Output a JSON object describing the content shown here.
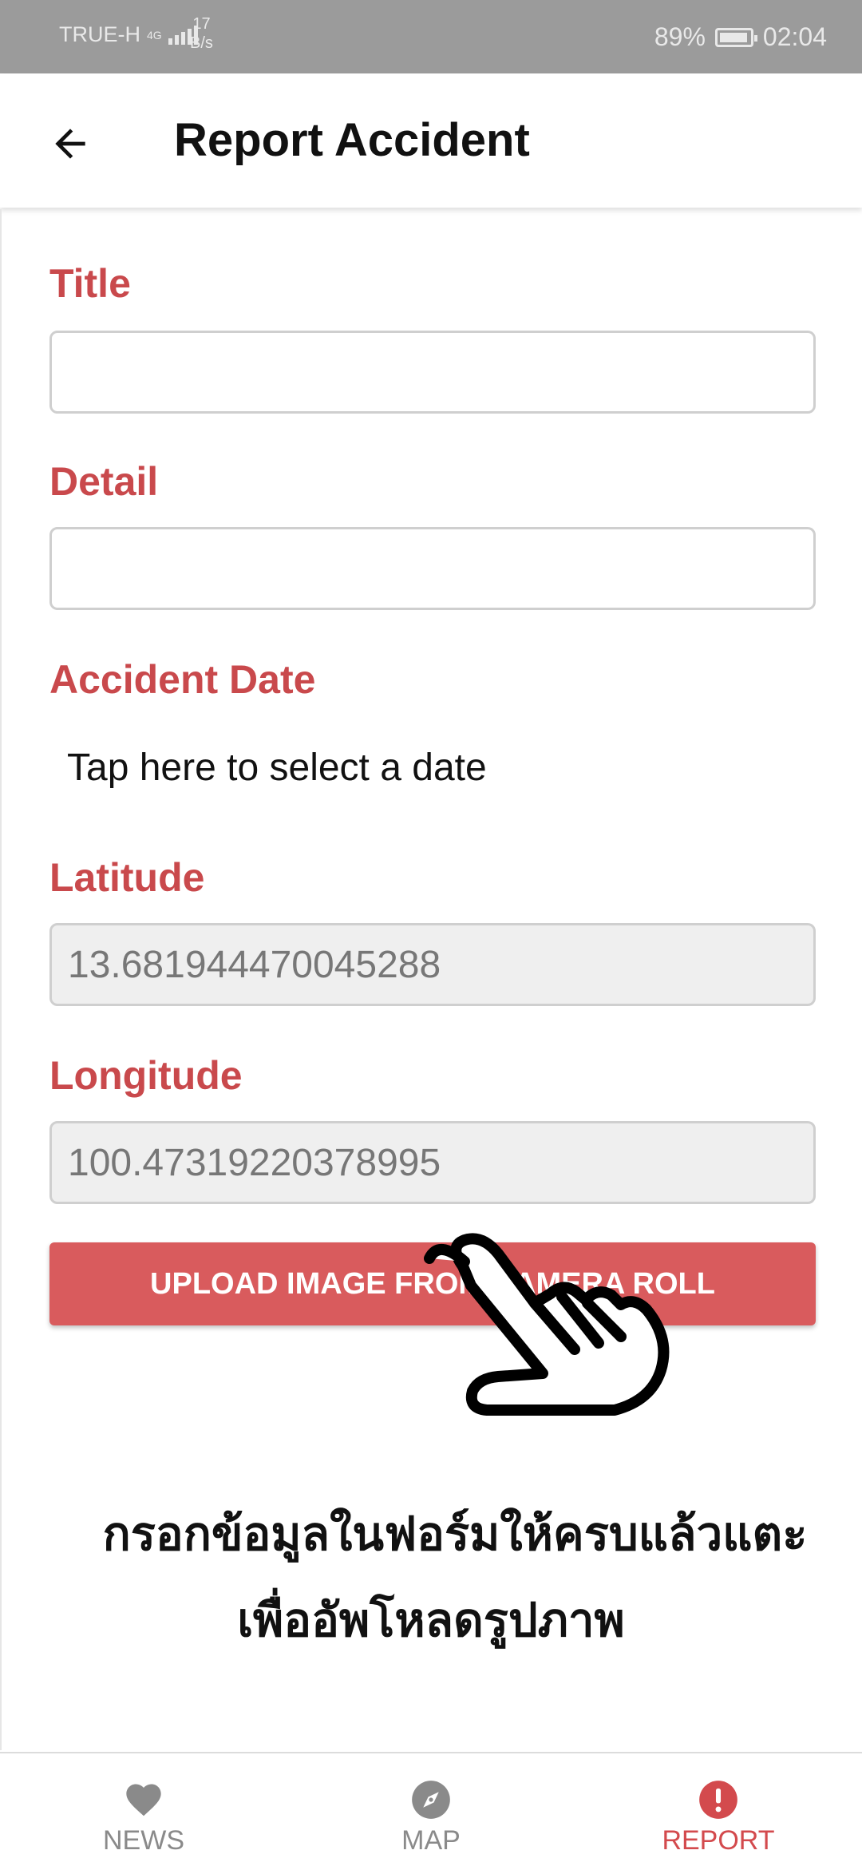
{
  "status_bar": {
    "carrier": "TRUE-H",
    "network": "4G",
    "speed_value": "17",
    "speed_unit": "B/s",
    "battery": "89%",
    "time": "02:04"
  },
  "appbar": {
    "back_icon": "arrow-left-icon",
    "title": "Report Accident"
  },
  "form": {
    "title_label": "Title",
    "title_value": "",
    "detail_label": "Detail",
    "detail_value": "",
    "date_label": "Accident Date",
    "date_prompt": "Tap here to select a date",
    "latitude_label": "Latitude",
    "latitude_value": "13.681944470045288",
    "longitude_label": "Longitude",
    "longitude_value": "100.47319220378995",
    "upload_button": "UPLOAD IMAGE FROM CAMERA ROLL"
  },
  "hint": {
    "line1": "กรอกข้อมูลในฟอร์มให้ครบแล้วแตะ",
    "line2": "เพื่ออัพโหลดรูปภาพ"
  },
  "bottom_nav": {
    "items": [
      {
        "label": "NEWS",
        "icon": "heart-icon"
      },
      {
        "label": "MAP",
        "icon": "compass-icon"
      },
      {
        "label": "REPORT",
        "icon": "alert-icon"
      }
    ],
    "active": "REPORT"
  },
  "colors": {
    "accent": "#c9494c",
    "button": "#d95b5d",
    "statusbar": "#9b9b9b",
    "nav_inactive": "#8a8a8a"
  }
}
